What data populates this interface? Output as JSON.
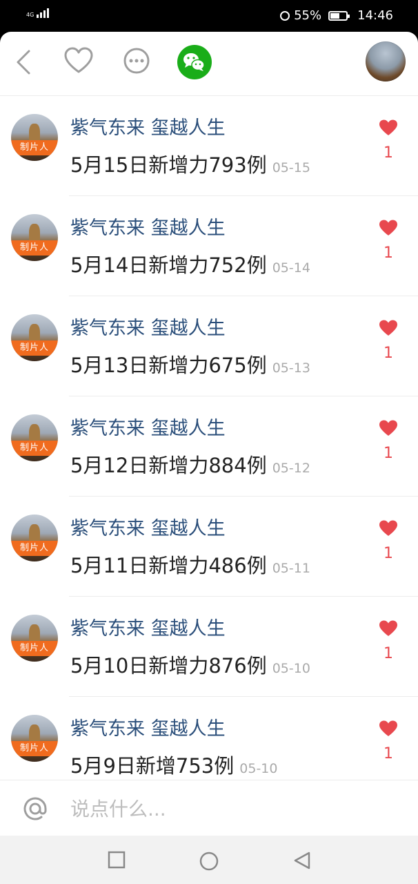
{
  "status_bar": {
    "network": "4G",
    "battery": "55%",
    "time": "14:46"
  },
  "topbar": {
    "icons": [
      "back-icon",
      "heart-icon",
      "more-icon",
      "wechat-icon"
    ],
    "wechat_color": "#1aad19"
  },
  "comments": [
    {
      "author": "紫气东来  玺越人生",
      "badge": "制片人",
      "text": "5月15日新增力793例",
      "date": "05-15",
      "likes": "1"
    },
    {
      "author": "紫气东来  玺越人生",
      "badge": "制片人",
      "text": "5月14日新增力752例",
      "date": "05-14",
      "likes": "1"
    },
    {
      "author": "紫气东来  玺越人生",
      "badge": "制片人",
      "text": "5月13日新增力675例",
      "date": "05-13",
      "likes": "1"
    },
    {
      "author": "紫气东来  玺越人生",
      "badge": "制片人",
      "text": "5月12日新增力884例",
      "date": "05-12",
      "likes": "1"
    },
    {
      "author": "紫气东来  玺越人生",
      "badge": "制片人",
      "text": "5月11日新增力486例",
      "date": "05-11",
      "likes": "1"
    },
    {
      "author": "紫气东来  玺越人生",
      "badge": "制片人",
      "text": "5月10日新增力876例",
      "date": "05-10",
      "likes": "1"
    },
    {
      "author": "紫气东来  玺越人生",
      "badge": "制片人",
      "text": "5月9日新增753例",
      "date": "05-10",
      "likes": "1"
    }
  ],
  "colors": {
    "author": "#2a4e7a",
    "like": "#e8484e",
    "badge": "#f06b1e"
  },
  "input": {
    "placeholder": "说点什么..."
  },
  "navbar": {
    "icons": [
      "square-icon",
      "home-circle-icon",
      "back-triangle-icon"
    ]
  }
}
